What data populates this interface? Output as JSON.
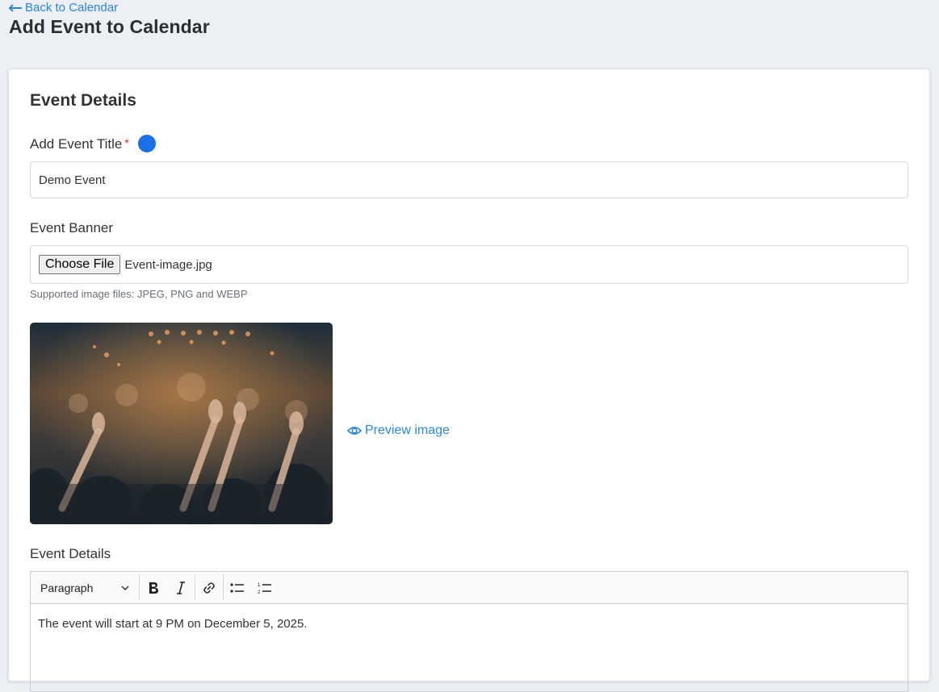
{
  "header": {
    "back_label": "Back to Calendar",
    "page_title": "Add Event to Calendar"
  },
  "card": {
    "title": "Event Details"
  },
  "fields": {
    "event_title": {
      "label": "Add Event Title",
      "required_mark": "*",
      "value": "Demo Event"
    },
    "event_banner": {
      "label": "Event Banner",
      "button_label": "Choose File",
      "file_name": "Event-image.jpg",
      "hint": "Supported image files: JPEG, PNG and WEBP",
      "preview_label": "Preview image"
    },
    "event_details": {
      "label": "Event Details",
      "heading_select": "Paragraph",
      "content": "The event will start at 9 PM on December 5, 2025."
    }
  },
  "icons": {
    "back": "arrow-left-icon",
    "preview": "eye-icon",
    "help": "info-dot-icon",
    "bold": "bold-icon",
    "italic": "italic-icon",
    "link": "link-icon",
    "bulleted": "bulleted-list-icon",
    "numbered": "numbered-list-icon",
    "dropdown": "chevron-down-icon"
  },
  "colors": {
    "accent": "#2c86d9",
    "help_dot": "#1c6fe8",
    "required": "#e02424",
    "background": "#eceff4"
  }
}
